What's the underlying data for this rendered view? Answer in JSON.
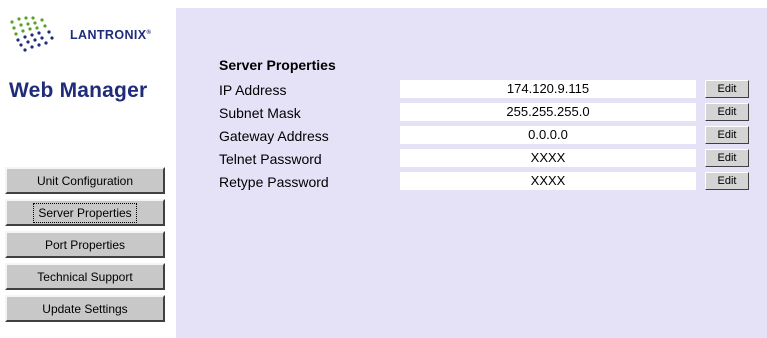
{
  "brand": {
    "logo_text": "LANTRONIX",
    "logo_mark": "®",
    "title": "Web Manager"
  },
  "nav": {
    "items": [
      {
        "label": "Unit Configuration",
        "active": false
      },
      {
        "label": "Server Properties",
        "active": true
      },
      {
        "label": "Port Properties",
        "active": false
      },
      {
        "label": "Technical Support",
        "active": false
      },
      {
        "label": "Update Settings",
        "active": false
      }
    ]
  },
  "server_properties": {
    "title": "Server Properties",
    "edit_label": "Edit",
    "rows": [
      {
        "label": "IP Address",
        "value": "174.120.9.115"
      },
      {
        "label": "Subnet Mask",
        "value": "255.255.255.0"
      },
      {
        "label": "Gateway Address",
        "value": "0.0.0.0"
      },
      {
        "label": "Telnet Password",
        "value": "XXXX"
      },
      {
        "label": "Retype Password",
        "value": "XXXX"
      }
    ]
  },
  "colors": {
    "brand_blue": "#1f2c7a",
    "logo_green": "#5aa02c",
    "panel_background": "#e5e2f7",
    "button_gray": "#c8c8c8"
  },
  "icons": {
    "logo": "lantronix-starburst-icon"
  }
}
